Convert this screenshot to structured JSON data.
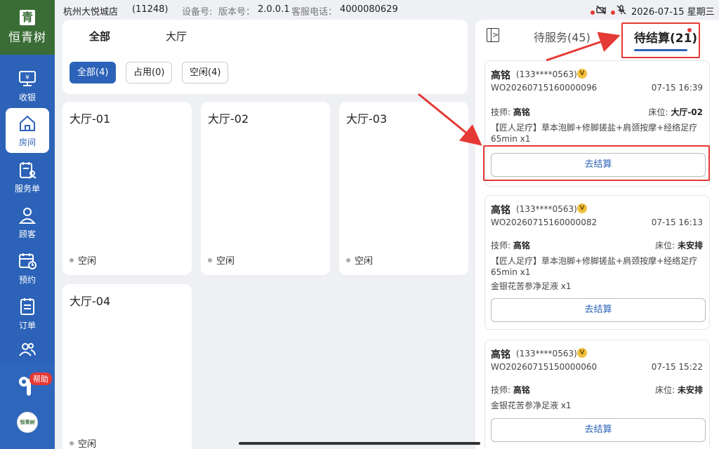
{
  "sidebar": {
    "logo_seal": "青",
    "logo_text": "恒青树",
    "items": [
      {
        "label": "收银",
        "icon": "cashier-icon"
      },
      {
        "label": "房间",
        "icon": "home-icon"
      },
      {
        "label": "服务单",
        "icon": "service-order-icon"
      },
      {
        "label": "顾客",
        "icon": "customer-icon"
      },
      {
        "label": "预约",
        "icon": "calendar-icon"
      },
      {
        "label": "订单",
        "icon": "order-icon"
      },
      {
        "label": "",
        "icon": "group-icon"
      }
    ],
    "help_badge": "帮助",
    "avatar_text": "恒青树"
  },
  "status": {
    "store": "杭州大悦城店",
    "store_id": "(11248)",
    "device_label": "设备号:",
    "version_label": "版本号：",
    "version": "2.0.0.1",
    "hotline_label": "客服电话：",
    "hotline": "4000080629",
    "date": "2026-07-15 星期三"
  },
  "filters": {
    "areas": [
      "全部",
      "大厅"
    ],
    "chips": [
      "全部(4)",
      "占用(0)",
      "空闲(4)"
    ]
  },
  "rooms": [
    {
      "name": "大厅-01",
      "status": "空闲"
    },
    {
      "name": "大厅-02",
      "status": "空闲"
    },
    {
      "name": "大厅-03",
      "status": "空闲"
    },
    {
      "name": "大厅-04",
      "status": "空闲"
    }
  ],
  "panel": {
    "collapse_glyph": ">",
    "tab_waiting_service": "待服务(45)",
    "tab_waiting_checkout": "待结算(21)"
  },
  "labels": {
    "tech": "技师:",
    "bed": "床位:",
    "checkout": "去结算"
  },
  "orders": [
    {
      "name": "高铭",
      "phone": "(133****0563)",
      "vip": "V",
      "no": "WO20260715160000096",
      "time": "07-15 16:39",
      "tech": "高铭",
      "bed": "大厅-02",
      "item1": "【匠人足疗】草本泡脚+修脚搓盐+肩颈按摩+经络足疗",
      "item1b": "65min x1",
      "item2": ""
    },
    {
      "name": "高铭",
      "phone": "(133****0563)",
      "vip": "V",
      "no": "WO20260715160000082",
      "time": "07-15 16:13",
      "tech": "高铭",
      "bed": "未安排",
      "item1": "【匠人足疗】草本泡脚+修脚搓盐+肩颈按摩+经络足疗",
      "item1b": "65min x1",
      "item2": "金银花苦参净足液 x1"
    },
    {
      "name": "高铭",
      "phone": "(133****0563)",
      "vip": "V",
      "no": "WO20260715150000060",
      "time": "07-15 15:22",
      "tech": "高铭",
      "bed": "未安排",
      "item1": "金银花苦参净足液 x1",
      "item1b": "",
      "item2": ""
    }
  ],
  "colors": {
    "primary": "#2c63b8",
    "logo_green": "#3a6d35",
    "annotation_red": "#e53935"
  }
}
